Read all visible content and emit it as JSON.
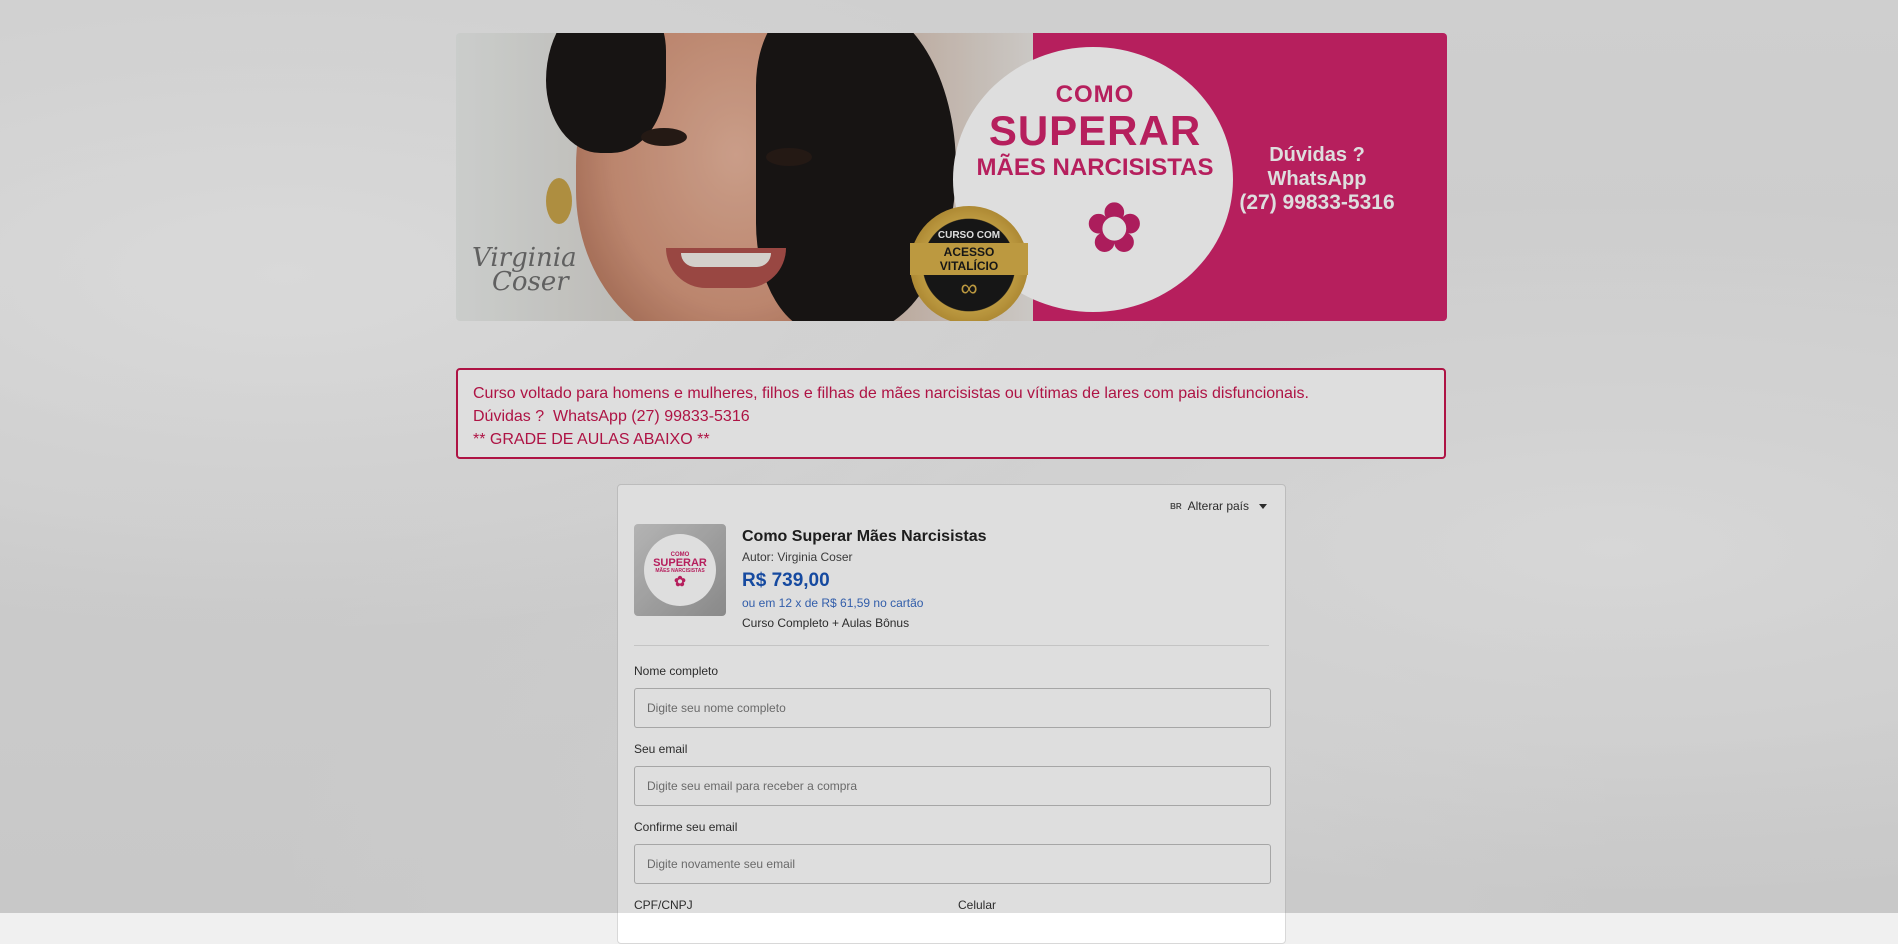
{
  "banner": {
    "signature_line1": "Virginia",
    "signature_line2": "Coser",
    "course_title_line1": "COMO",
    "course_title_line2": "SUPERAR",
    "course_title_line3": "MÃES NARCISISTAS",
    "seal_top": "CURSO COM",
    "seal_middle": "ACESSO VITALÍCIO",
    "seal_symbol": "∞",
    "contact_line1": "Dúvidas ?",
    "contact_line2": "WhatsApp",
    "contact_phone": "(27) 99833-5316",
    "brand_color": "#d1246b",
    "icons": [
      "lotus-icon",
      "infinity-icon"
    ]
  },
  "info_box": {
    "line1": "Curso voltado para homens e mulheres, filhos e filhas de mães narcisistas ou vítimas de lares com pais disfuncionais.",
    "line2": "Dúvidas ?  WhatsApp (27) 99833-5316",
    "line3": "** GRADE DE AULAS ABAIXO **",
    "accent_color": "#c8164f"
  },
  "checkout": {
    "country_flag": "BR",
    "country_label": "Alterar país",
    "product": {
      "thumb_line1": "COMO",
      "thumb_line2": "SUPERAR",
      "thumb_line3": "MÃES NARCISISTAS",
      "name": "Como Superar Mães Narcisistas",
      "author": "Autor: Virginia Coser",
      "price": "R$ 739,00",
      "installments": "ou em 12 x de R$ 61,59 no cartão",
      "description": "Curso Completo + Aulas Bônus",
      "price_color": "#1a56b8"
    },
    "form": {
      "name_label": "Nome completo",
      "name_placeholder": "Digite seu nome completo",
      "email_label": "Seu email",
      "email_placeholder": "Digite seu email para receber a compra",
      "confirm_label": "Confirme seu email",
      "confirm_placeholder": "Digite novamente seu email",
      "cpf_label": "CPF/CNPJ",
      "phone_label": "Celular"
    }
  }
}
